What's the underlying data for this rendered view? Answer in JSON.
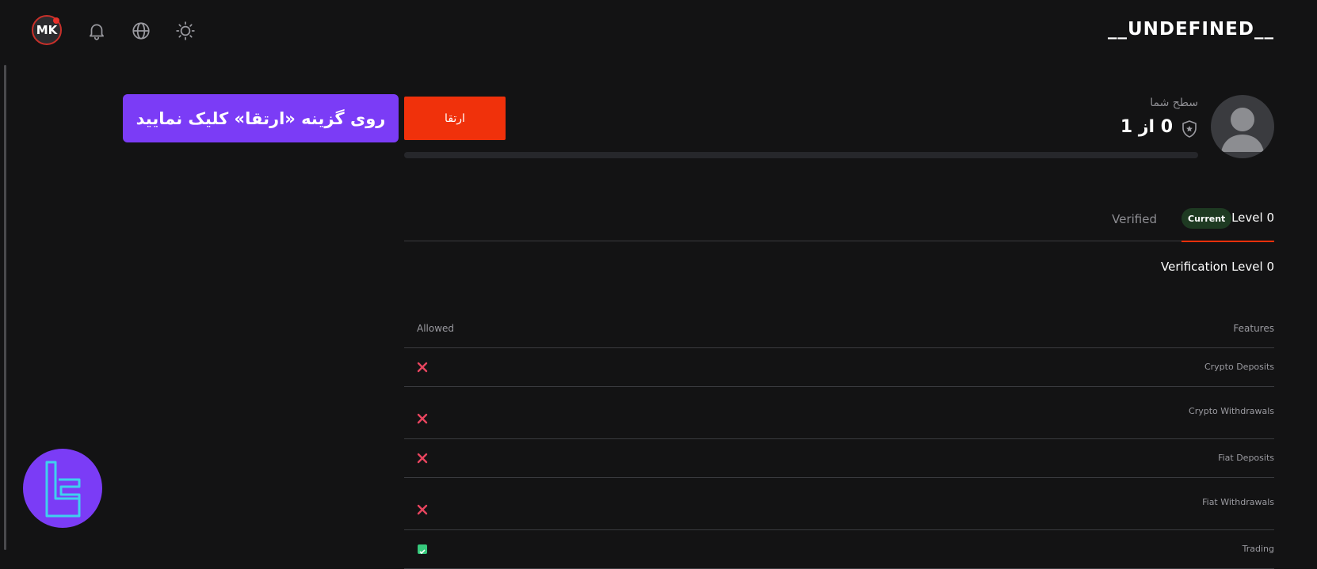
{
  "header": {
    "avatar_initials": "MK",
    "brand": "__UNDEFINED__",
    "icons": [
      "bell-icon",
      "globe-icon",
      "sun-icon"
    ]
  },
  "promo": {
    "callout_text": "روی گزینه «ارتقا» کلیک نمایید",
    "upgrade_label": "ارتقا"
  },
  "level": {
    "caption": "سطح شما",
    "value": "0 از 1",
    "progress_fraction": 0
  },
  "tabs": {
    "verified_label": "Verified",
    "current_badge": "Current",
    "level_label": "Level 0"
  },
  "verification": {
    "title": "Verification Level 0"
  },
  "table": {
    "col_allowed": "Allowed",
    "col_features": "Features",
    "rows": [
      {
        "feature": "Crypto Deposits",
        "allowed": false
      },
      {
        "feature": "Crypto Withdrawals",
        "allowed": false
      },
      {
        "feature": "Fiat Deposits",
        "allowed": false
      },
      {
        "feature": "Fiat Withdrawals",
        "allowed": false
      },
      {
        "feature": "Trading",
        "allowed": true
      }
    ]
  },
  "colors": {
    "accent_orange": "#f0310b",
    "purple": "#7b3cf6",
    "deny_red": "#e8455f",
    "allow_green": "#36c97c",
    "background": "#131314"
  }
}
